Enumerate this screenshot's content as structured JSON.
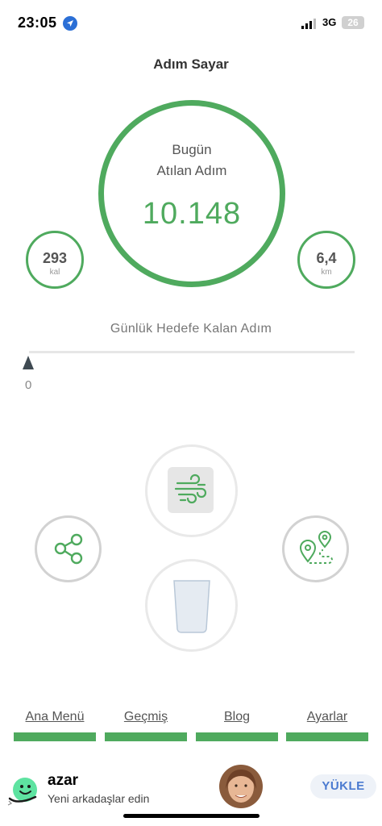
{
  "status_bar": {
    "time": "23:05",
    "network": "3G",
    "battery": "26"
  },
  "header": {
    "title": "Adım Sayar"
  },
  "steps_ring": {
    "line1": "Bugün",
    "line2": "Atılan Adım",
    "value": "10.148"
  },
  "calories": {
    "value": "293",
    "unit": "kal"
  },
  "distance": {
    "value": "6,4",
    "unit": "km"
  },
  "goal": {
    "label": "Günlük Hedefe Kalan Adım",
    "remaining": "0"
  },
  "actions": {
    "icons": [
      "wind-icon",
      "share-icon",
      "route-map-icon",
      "water-glass-icon"
    ]
  },
  "nav": {
    "home": "Ana Menü",
    "history": "Geçmiş",
    "blog": "Blog",
    "settings": "Ayarlar"
  },
  "ad": {
    "name": "azar",
    "subtitle": "Yeni arkadaşlar edin",
    "button": "YÜKLE"
  },
  "colors": {
    "accent": "#4faa5e",
    "ad_button_text": "#4a7ad0"
  }
}
